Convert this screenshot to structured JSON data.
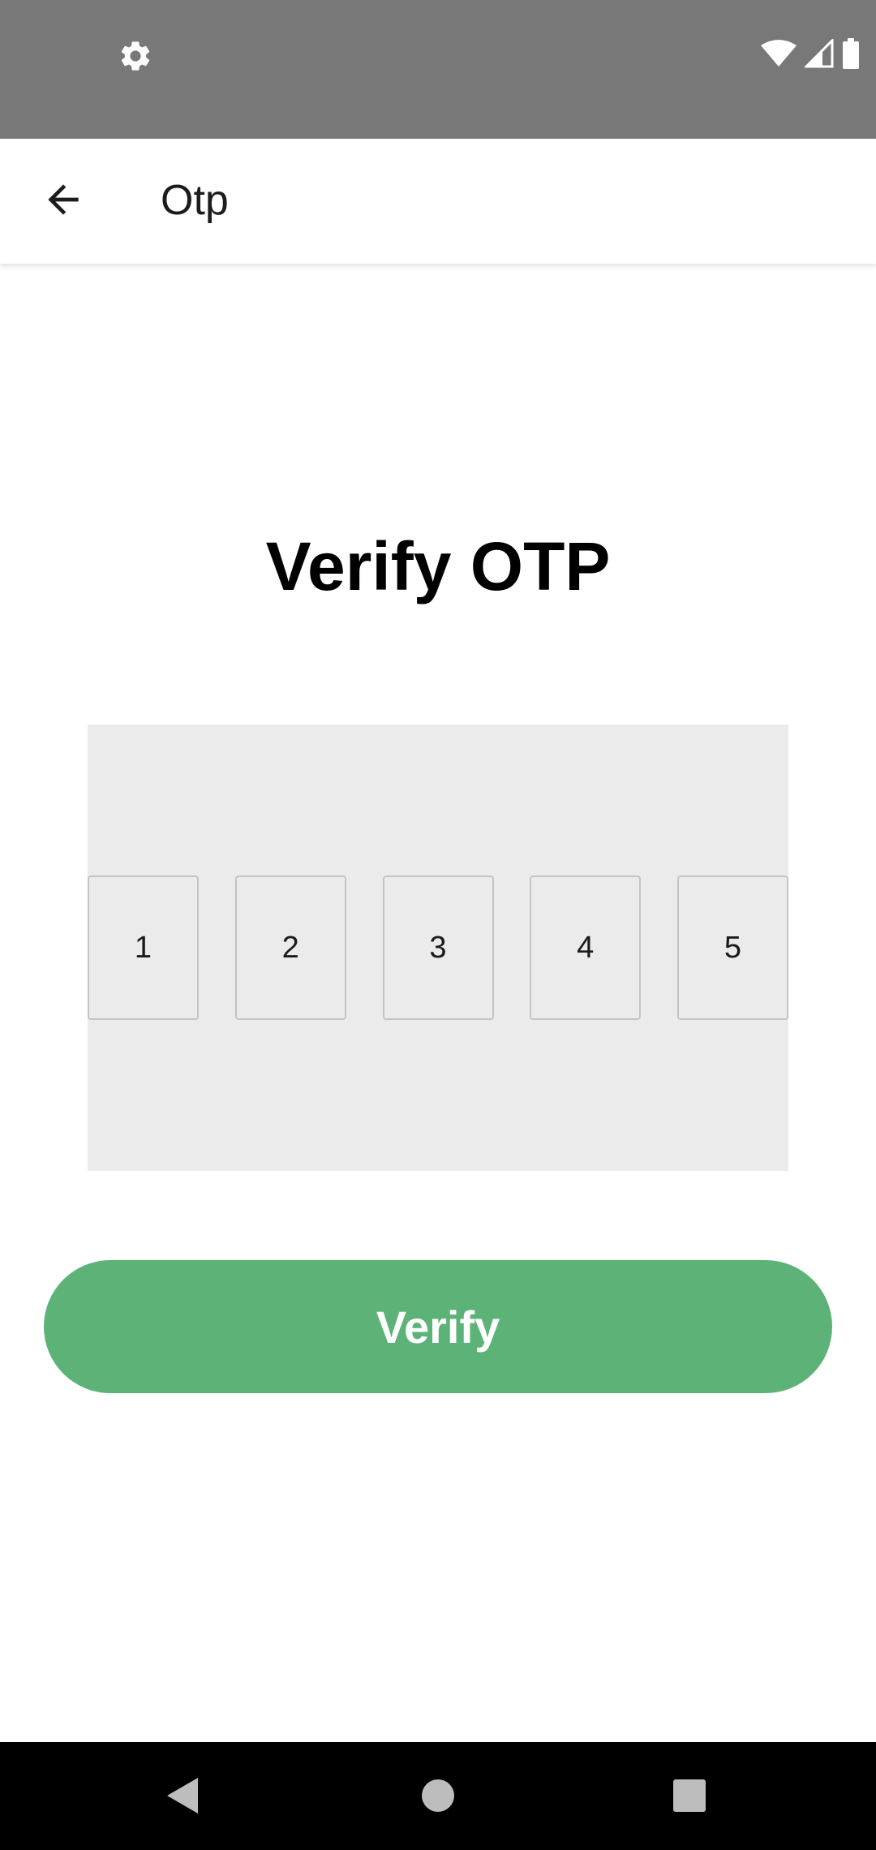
{
  "status_bar": {
    "left_icon": "gear-icon",
    "right_icons": [
      "wifi-icon",
      "signal-icon",
      "battery-icon"
    ]
  },
  "app_bar": {
    "back_icon": "back-arrow-icon",
    "title": "Otp"
  },
  "main": {
    "heading": "Verify OTP",
    "otp_digits": [
      "1",
      "2",
      "3",
      "4",
      "5"
    ],
    "verify_label": "Verify"
  },
  "nav_bar": {
    "icons": [
      "nav-back-icon",
      "nav-home-icon",
      "nav-recents-icon"
    ]
  },
  "colors": {
    "status_bar": "#787878",
    "accent_green": "#5db377",
    "otp_panel": "#ebebeb"
  }
}
